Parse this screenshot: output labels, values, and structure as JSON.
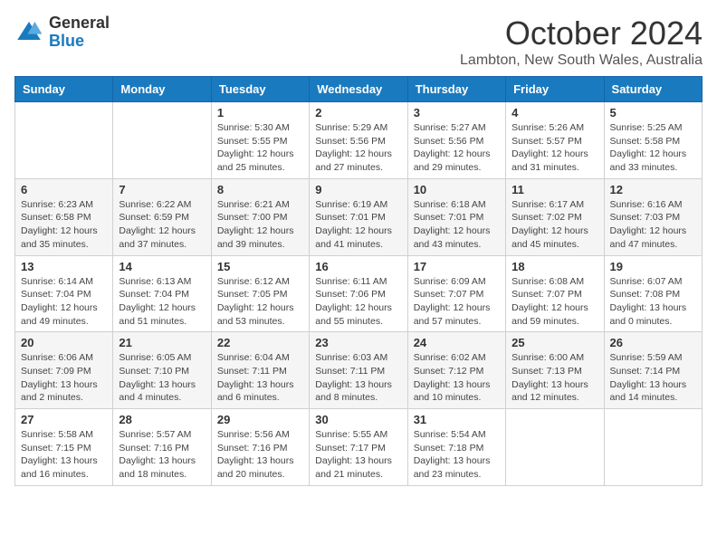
{
  "logo": {
    "general": "General",
    "blue": "Blue"
  },
  "header": {
    "month": "October 2024",
    "subtitle": "Lambton, New South Wales, Australia"
  },
  "weekdays": [
    "Sunday",
    "Monday",
    "Tuesday",
    "Wednesday",
    "Thursday",
    "Friday",
    "Saturday"
  ],
  "weeks": [
    [
      {
        "day": "",
        "info": ""
      },
      {
        "day": "",
        "info": ""
      },
      {
        "day": "1",
        "info": "Sunrise: 5:30 AM\nSunset: 5:55 PM\nDaylight: 12 hours\nand 25 minutes."
      },
      {
        "day": "2",
        "info": "Sunrise: 5:29 AM\nSunset: 5:56 PM\nDaylight: 12 hours\nand 27 minutes."
      },
      {
        "day": "3",
        "info": "Sunrise: 5:27 AM\nSunset: 5:56 PM\nDaylight: 12 hours\nand 29 minutes."
      },
      {
        "day": "4",
        "info": "Sunrise: 5:26 AM\nSunset: 5:57 PM\nDaylight: 12 hours\nand 31 minutes."
      },
      {
        "day": "5",
        "info": "Sunrise: 5:25 AM\nSunset: 5:58 PM\nDaylight: 12 hours\nand 33 minutes."
      }
    ],
    [
      {
        "day": "6",
        "info": "Sunrise: 6:23 AM\nSunset: 6:58 PM\nDaylight: 12 hours\nand 35 minutes."
      },
      {
        "day": "7",
        "info": "Sunrise: 6:22 AM\nSunset: 6:59 PM\nDaylight: 12 hours\nand 37 minutes."
      },
      {
        "day": "8",
        "info": "Sunrise: 6:21 AM\nSunset: 7:00 PM\nDaylight: 12 hours\nand 39 minutes."
      },
      {
        "day": "9",
        "info": "Sunrise: 6:19 AM\nSunset: 7:01 PM\nDaylight: 12 hours\nand 41 minutes."
      },
      {
        "day": "10",
        "info": "Sunrise: 6:18 AM\nSunset: 7:01 PM\nDaylight: 12 hours\nand 43 minutes."
      },
      {
        "day": "11",
        "info": "Sunrise: 6:17 AM\nSunset: 7:02 PM\nDaylight: 12 hours\nand 45 minutes."
      },
      {
        "day": "12",
        "info": "Sunrise: 6:16 AM\nSunset: 7:03 PM\nDaylight: 12 hours\nand 47 minutes."
      }
    ],
    [
      {
        "day": "13",
        "info": "Sunrise: 6:14 AM\nSunset: 7:04 PM\nDaylight: 12 hours\nand 49 minutes."
      },
      {
        "day": "14",
        "info": "Sunrise: 6:13 AM\nSunset: 7:04 PM\nDaylight: 12 hours\nand 51 minutes."
      },
      {
        "day": "15",
        "info": "Sunrise: 6:12 AM\nSunset: 7:05 PM\nDaylight: 12 hours\nand 53 minutes."
      },
      {
        "day": "16",
        "info": "Sunrise: 6:11 AM\nSunset: 7:06 PM\nDaylight: 12 hours\nand 55 minutes."
      },
      {
        "day": "17",
        "info": "Sunrise: 6:09 AM\nSunset: 7:07 PM\nDaylight: 12 hours\nand 57 minutes."
      },
      {
        "day": "18",
        "info": "Sunrise: 6:08 AM\nSunset: 7:07 PM\nDaylight: 12 hours\nand 59 minutes."
      },
      {
        "day": "19",
        "info": "Sunrise: 6:07 AM\nSunset: 7:08 PM\nDaylight: 13 hours\nand 0 minutes."
      }
    ],
    [
      {
        "day": "20",
        "info": "Sunrise: 6:06 AM\nSunset: 7:09 PM\nDaylight: 13 hours\nand 2 minutes."
      },
      {
        "day": "21",
        "info": "Sunrise: 6:05 AM\nSunset: 7:10 PM\nDaylight: 13 hours\nand 4 minutes."
      },
      {
        "day": "22",
        "info": "Sunrise: 6:04 AM\nSunset: 7:11 PM\nDaylight: 13 hours\nand 6 minutes."
      },
      {
        "day": "23",
        "info": "Sunrise: 6:03 AM\nSunset: 7:11 PM\nDaylight: 13 hours\nand 8 minutes."
      },
      {
        "day": "24",
        "info": "Sunrise: 6:02 AM\nSunset: 7:12 PM\nDaylight: 13 hours\nand 10 minutes."
      },
      {
        "day": "25",
        "info": "Sunrise: 6:00 AM\nSunset: 7:13 PM\nDaylight: 13 hours\nand 12 minutes."
      },
      {
        "day": "26",
        "info": "Sunrise: 5:59 AM\nSunset: 7:14 PM\nDaylight: 13 hours\nand 14 minutes."
      }
    ],
    [
      {
        "day": "27",
        "info": "Sunrise: 5:58 AM\nSunset: 7:15 PM\nDaylight: 13 hours\nand 16 minutes."
      },
      {
        "day": "28",
        "info": "Sunrise: 5:57 AM\nSunset: 7:16 PM\nDaylight: 13 hours\nand 18 minutes."
      },
      {
        "day": "29",
        "info": "Sunrise: 5:56 AM\nSunset: 7:16 PM\nDaylight: 13 hours\nand 20 minutes."
      },
      {
        "day": "30",
        "info": "Sunrise: 5:55 AM\nSunset: 7:17 PM\nDaylight: 13 hours\nand 21 minutes."
      },
      {
        "day": "31",
        "info": "Sunrise: 5:54 AM\nSunset: 7:18 PM\nDaylight: 13 hours\nand 23 minutes."
      },
      {
        "day": "",
        "info": ""
      },
      {
        "day": "",
        "info": ""
      }
    ]
  ]
}
